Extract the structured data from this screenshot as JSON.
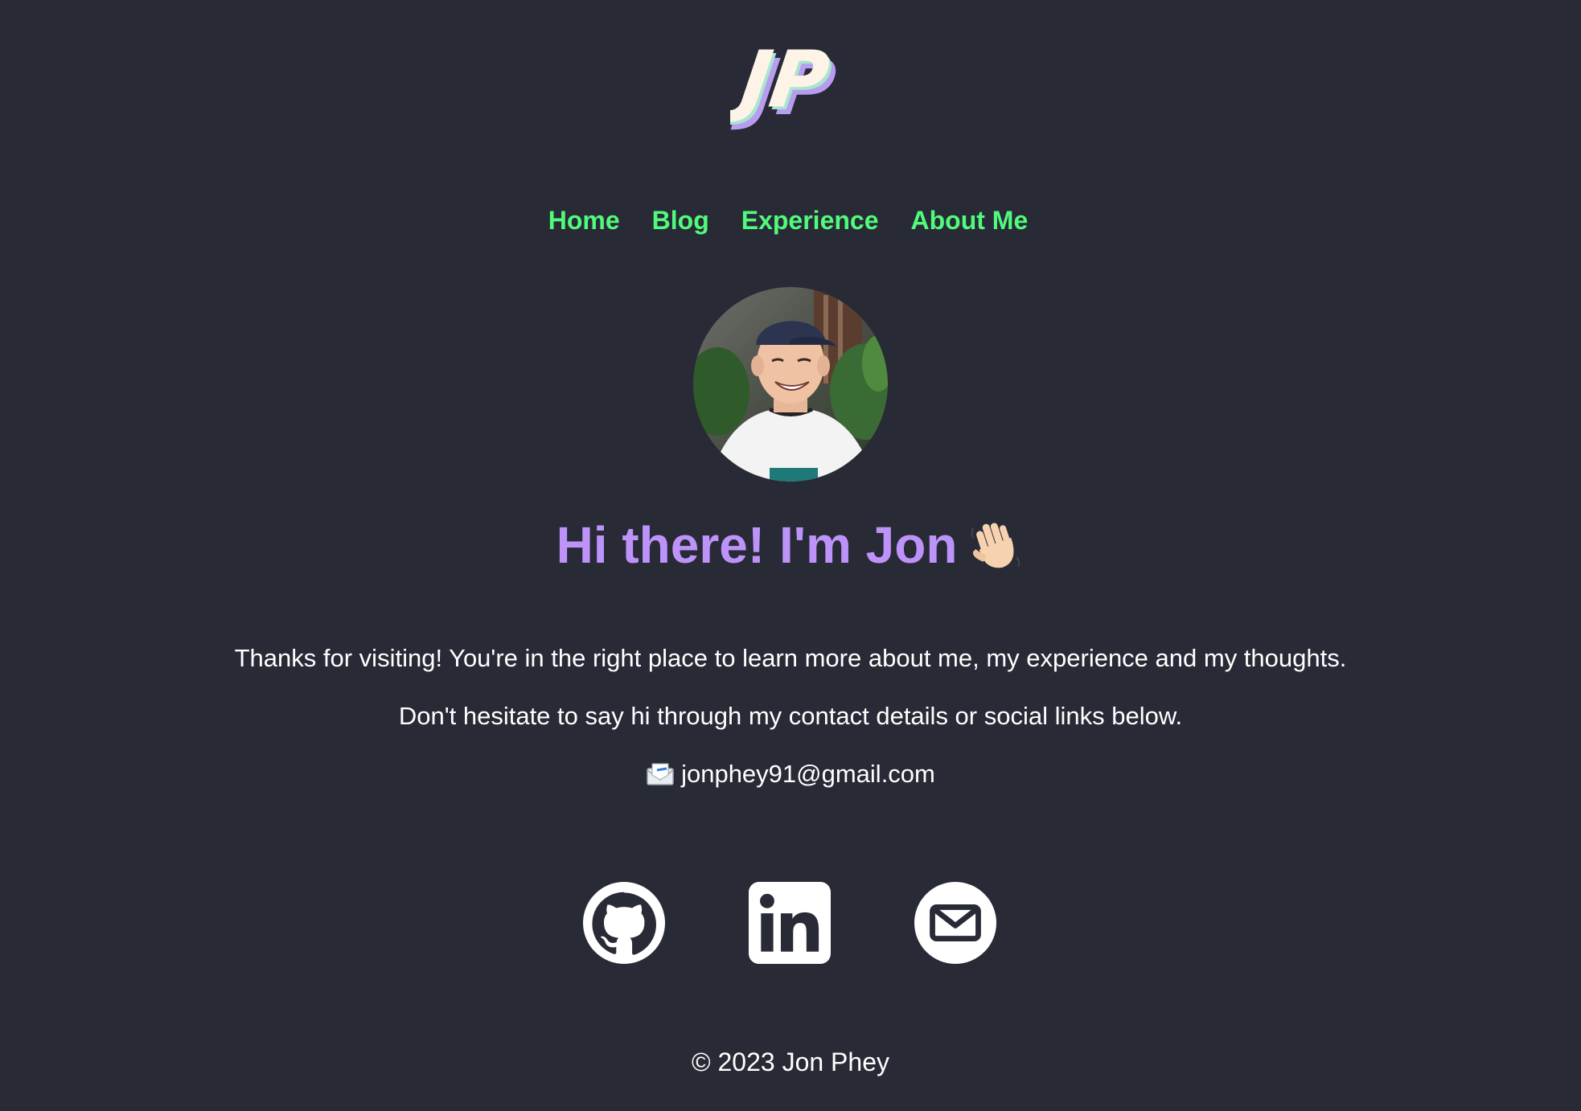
{
  "logo": {
    "text": "JP",
    "alt": "JP logo"
  },
  "nav": {
    "items": [
      {
        "label": "Home"
      },
      {
        "label": "Blog"
      },
      {
        "label": "Experience"
      },
      {
        "label": "About Me"
      }
    ]
  },
  "profile": {
    "avatar_alt": "Photo of Jon wearing a navy cap and white New Balance t-shirt",
    "headline": "Hi there! I'm Jon",
    "wave_emoji": "👋"
  },
  "intro": {
    "line1": "Thanks for visiting! You're in the right place to learn more about me, my experience and my thoughts.",
    "line2": "Don't hesitate to say hi through my contact details or social links below.",
    "email_icon": "envelope-icon",
    "email": "jonphey91@gmail.com"
  },
  "socials": [
    {
      "name": "GitHub",
      "icon": "github-icon"
    },
    {
      "name": "LinkedIn",
      "icon": "linkedin-icon"
    },
    {
      "name": "Email",
      "icon": "mail-icon"
    }
  ],
  "footer": {
    "copyright": "© 2023 Jon Phey"
  },
  "colors": {
    "background": "#282a36",
    "nav_link": "#50fa7b",
    "headline": "#bd93f9",
    "text": "#ffffff"
  }
}
